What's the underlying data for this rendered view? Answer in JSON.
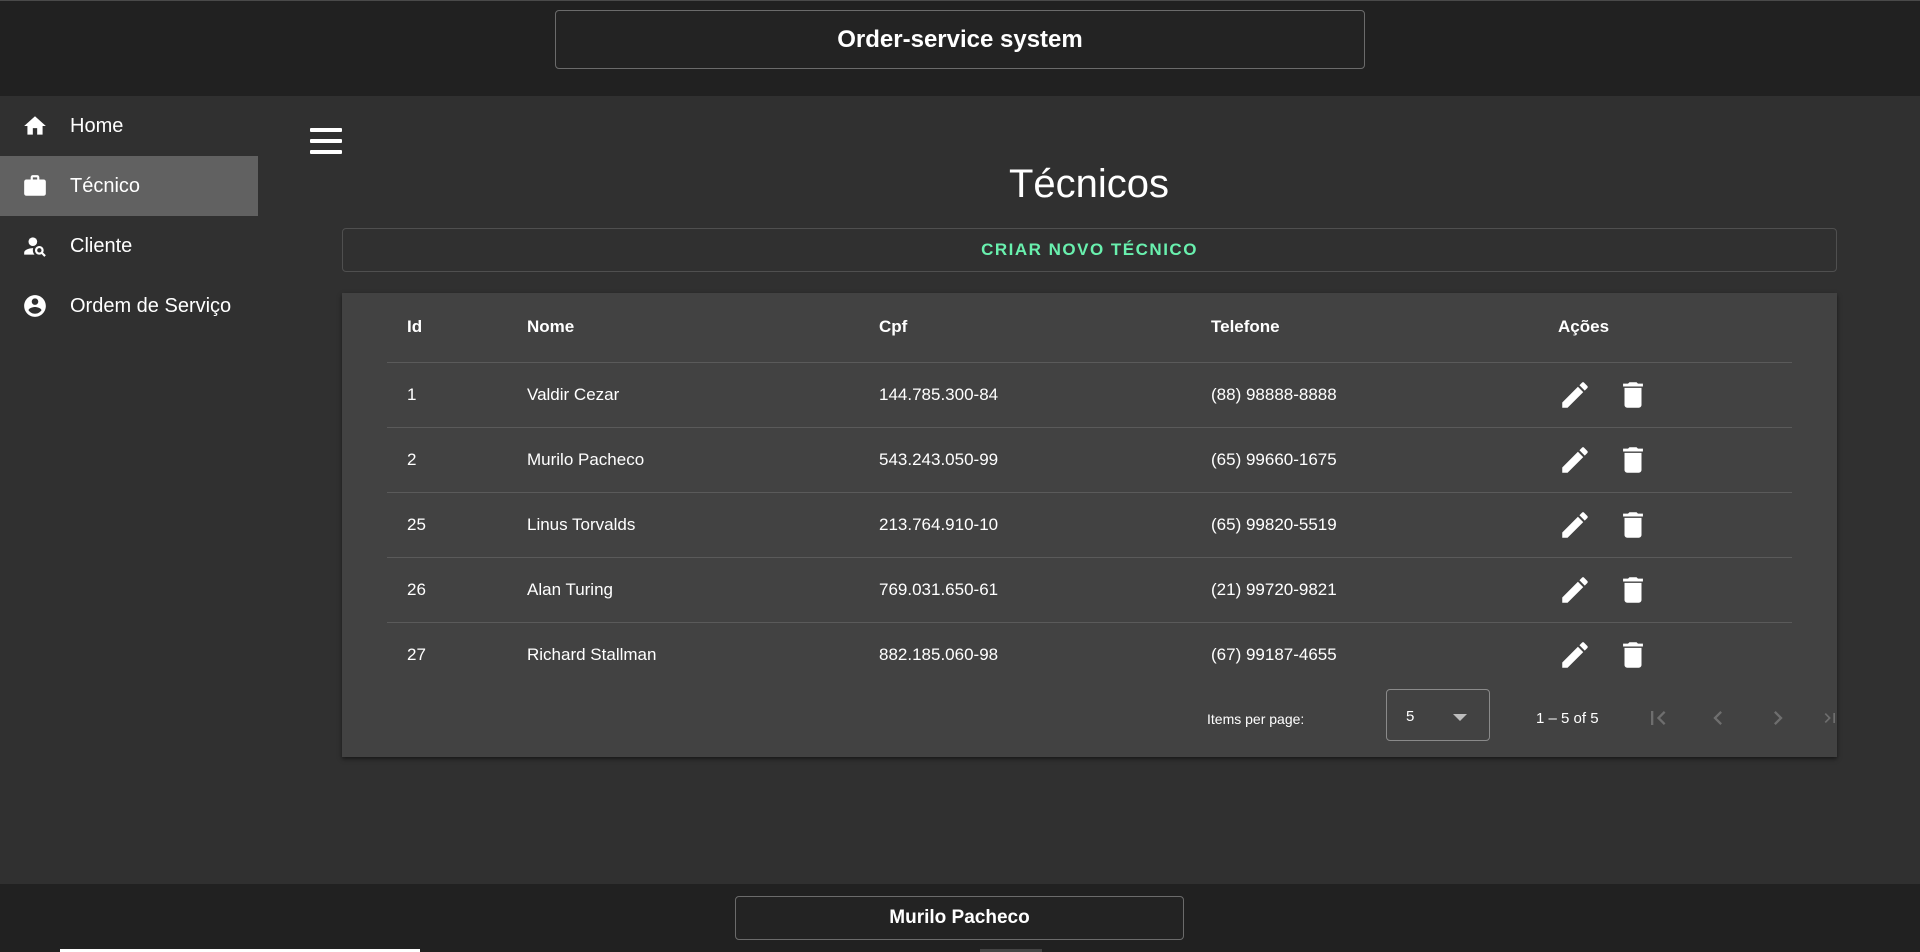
{
  "header": {
    "title": "Order-service system"
  },
  "sidebar": {
    "items": [
      {
        "label": "Home",
        "icon": "home-icon",
        "active": false
      },
      {
        "label": "Técnico",
        "icon": "briefcase-icon",
        "active": true
      },
      {
        "label": "Cliente",
        "icon": "person-search-icon",
        "active": false
      },
      {
        "label": "Ordem de Serviço",
        "icon": "account-circle-icon",
        "active": false
      }
    ]
  },
  "main": {
    "menu_icon": "menu-icon",
    "title": "Técnicos",
    "create_button": "CRIAR NOVO TÉCNICO",
    "table": {
      "headers": {
        "id": "Id",
        "nome": "Nome",
        "cpf": "Cpf",
        "telefone": "Telefone",
        "acoes": "Ações"
      },
      "rows": [
        {
          "id": "1",
          "nome": "Valdir Cezar",
          "cpf": "144.785.300-84",
          "telefone": "(88) 98888-8888"
        },
        {
          "id": "2",
          "nome": "Murilo Pacheco",
          "cpf": "543.243.050-99",
          "telefone": "(65) 99660-1675"
        },
        {
          "id": "25",
          "nome": "Linus Torvalds",
          "cpf": "213.764.910-10",
          "telefone": "(65) 99820-5519"
        },
        {
          "id": "26",
          "nome": "Alan Turing",
          "cpf": "769.031.650-61",
          "telefone": "(21) 99720-9821"
        },
        {
          "id": "27",
          "nome": "Richard Stallman",
          "cpf": "882.185.060-98",
          "telefone": "(67) 99187-4655"
        }
      ]
    },
    "paginator": {
      "items_per_page_label": "Items per page:",
      "items_per_page_value": "5",
      "range_label": "1 – 5 of 5"
    }
  },
  "footer": {
    "user": "Murilo Pacheco"
  },
  "colors": {
    "accent": "#69f0ae",
    "sidebar_active": "#616161",
    "card": "#424242",
    "background": "#303030"
  }
}
